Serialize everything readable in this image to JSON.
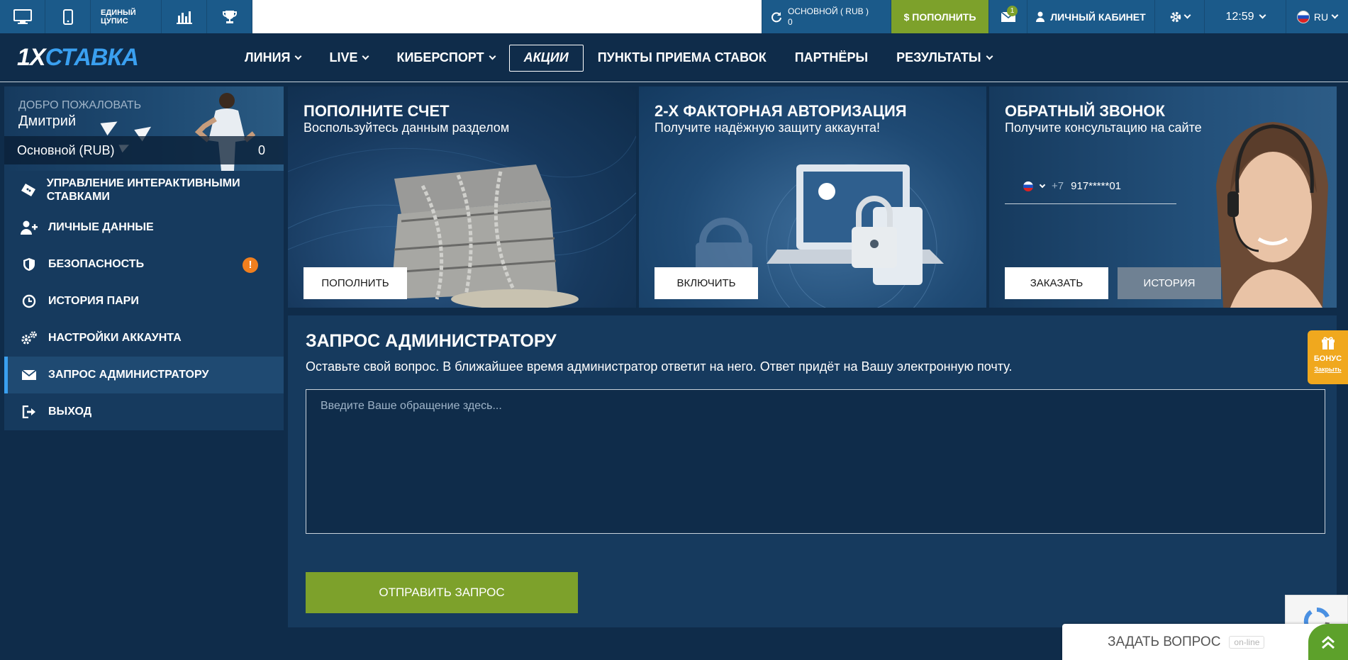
{
  "topbar": {
    "coupon_line1": "ЕДИНЫЙ",
    "coupon_line2": "ЦУПИС",
    "balance_label": "ОСНОВНОЙ ( RUB )",
    "balance_value": "0",
    "deposit_label": "$ ПОПОЛНИТЬ",
    "mail_count": "1",
    "cabinet_label": "ЛИЧНЫЙ КАБИНЕТ",
    "time": "12:59",
    "lang": "RU"
  },
  "nav": {
    "logo_one": "1X",
    "logo_rest": "СТАВКА",
    "items": [
      "ЛИНИЯ",
      "LIVE",
      "КИБЕРСПОРТ",
      "АКЦИИ",
      "ПУНКТЫ ПРИЕМА СТАВОК",
      "ПАРТНЁРЫ",
      "РЕЗУЛЬТАТЫ"
    ]
  },
  "sidebar": {
    "welcome": "ДОБРО ПОЖАЛОВАТЬ",
    "username": "Дмитрий",
    "account_label": "Основной (RUB)",
    "account_value": "0",
    "items": [
      {
        "label": "УПРАВЛЕНИЕ ИНТЕРАКТИВНЫМИ СТАВКАМИ"
      },
      {
        "label": "ЛИЧНЫЕ ДАННЫЕ"
      },
      {
        "label": "БЕЗОПАСНОСТЬ"
      },
      {
        "label": "ИСТОРИЯ ПАРИ"
      },
      {
        "label": "НАСТРОЙКИ АККАУНТА"
      },
      {
        "label": "ЗАПРОС АДМИНИСТРАТОРУ"
      },
      {
        "label": "ВЫХОД"
      }
    ],
    "warning_mark": "!"
  },
  "banners": [
    {
      "title": "ПОПОЛНИТЕ СЧЕТ",
      "subtitle": "Воспользуйтесь данным разделом",
      "button": "ПОПОЛНИТЬ"
    },
    {
      "title": "2-Х ФАКТОРНАЯ АВТОРИЗАЦИЯ",
      "subtitle": "Получите надёжную защиту аккаунта!",
      "button": "ВКЛЮЧИТЬ"
    },
    {
      "title": "ОБРАТНЫЙ ЗВОНОК",
      "subtitle": "Получите консультацию на сайте",
      "phone_code": "+7",
      "phone_number": "917*****01",
      "button": "ЗАКАЗАТЬ",
      "button2": "ИСТОРИЯ"
    }
  ],
  "main": {
    "title": "ЗАПРОС АДМИНИСТРАТОРУ",
    "subtitle": "Оставьте свой вопрос. В ближайшее время администратор ответит на него. Ответ придёт на Вашу электронную почту.",
    "placeholder": "Введите Ваше обращение здесь...",
    "submit": "ОТПРАВИТЬ ЗАПРОС"
  },
  "floating": {
    "bonus": "БОНУС",
    "bonus_close": "Закрыть",
    "ask": "ЗАДАТЬ ВОПРОС",
    "ask_status": "on-line"
  },
  "colors": {
    "background": "#0f2c4a",
    "panel": "#163a5e",
    "topbar_blue": "#1b5a8a",
    "accent_green": "#7da12b",
    "logo_blue": "#3aa0f0",
    "warning_orange": "#f07f1e",
    "bonus_orange": "#f0a81e"
  }
}
